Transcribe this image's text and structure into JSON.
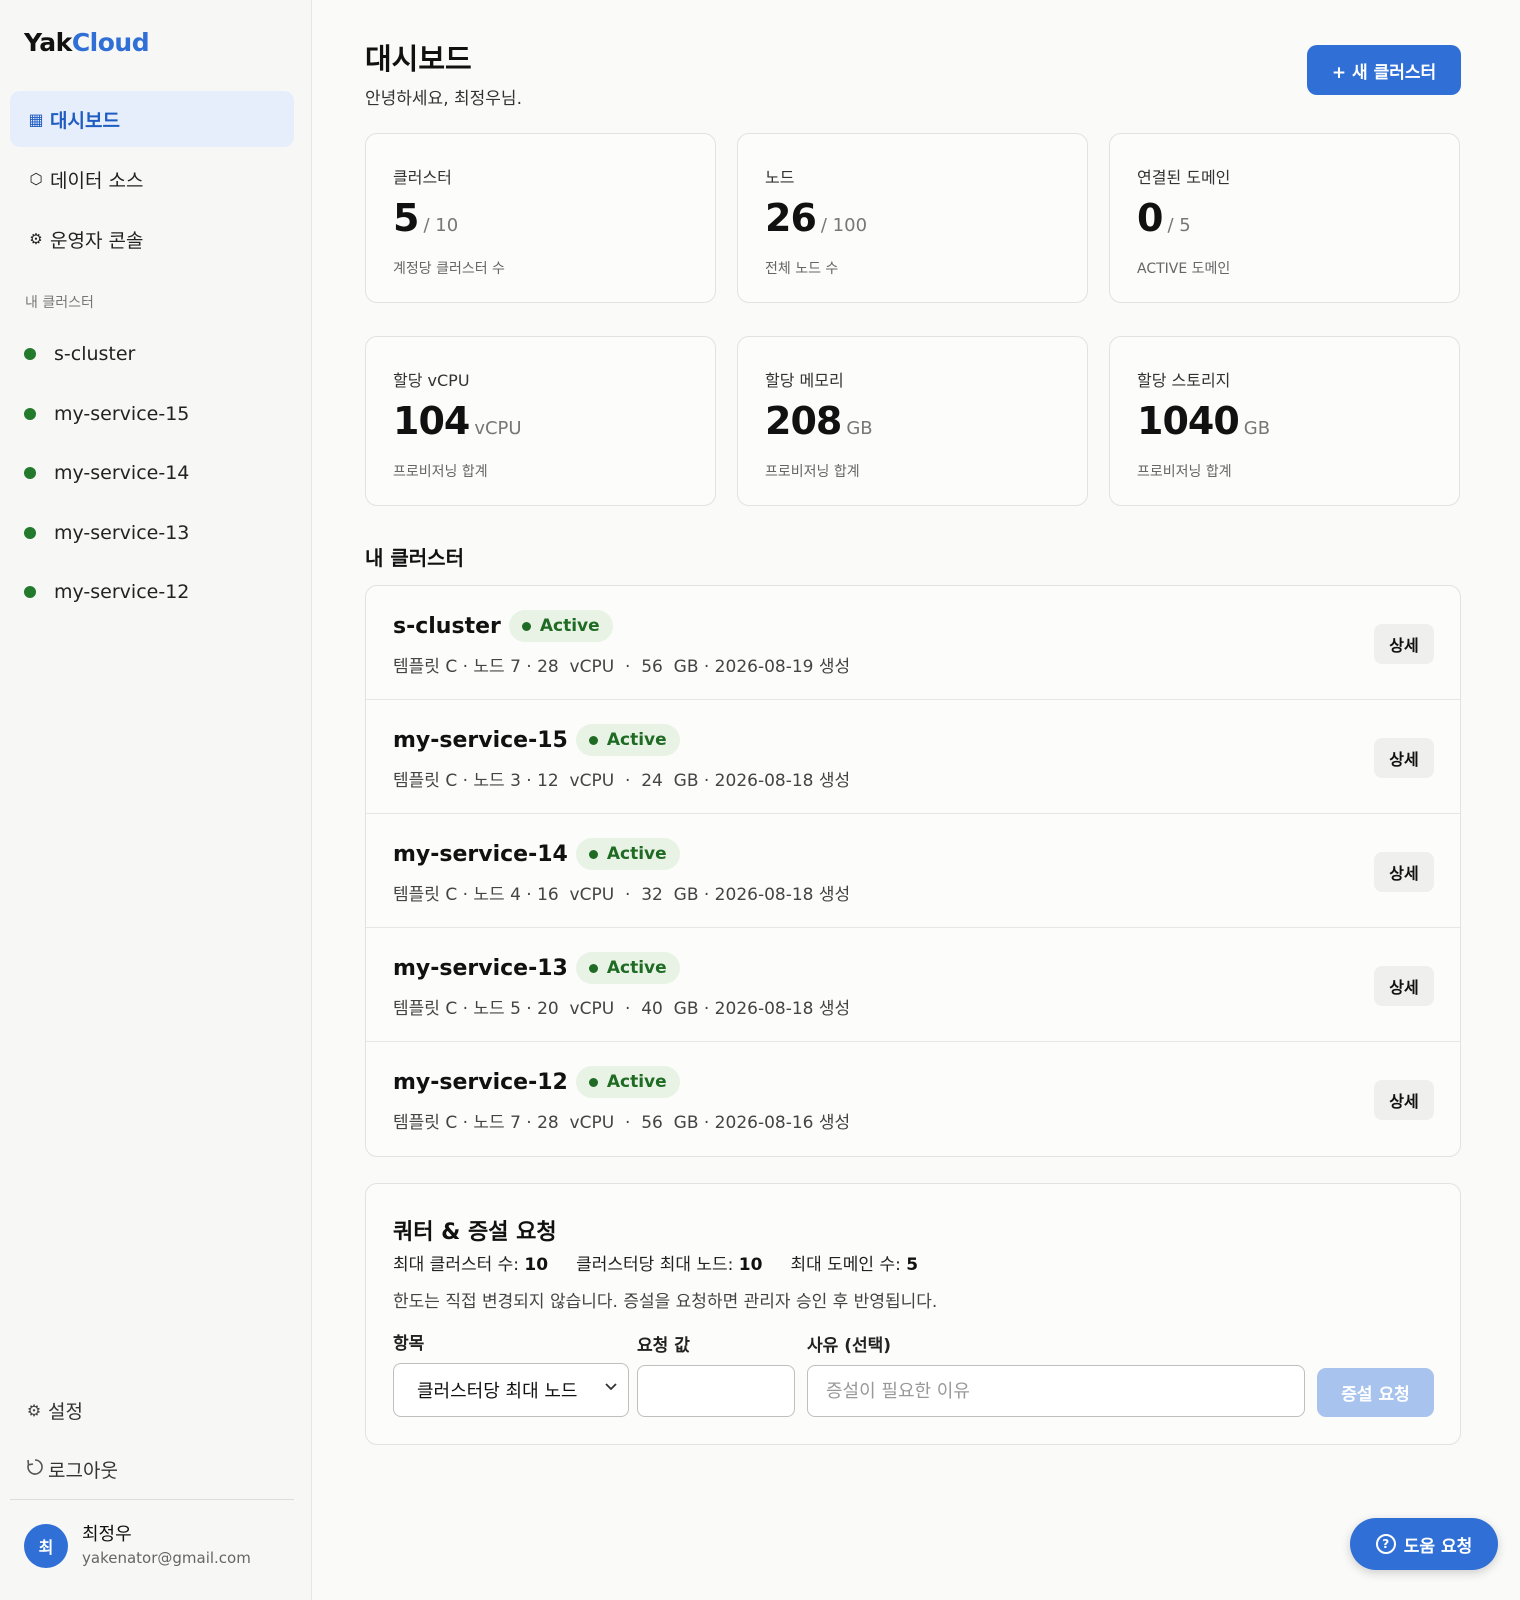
{
  "app": {
    "logo_part1": "Yak",
    "logo_part2": "Cloud"
  },
  "sidebar": {
    "nav": [
      {
        "icon": "grid-icon",
        "glyph": "▦",
        "label": "대시보드"
      },
      {
        "icon": "hexagon-icon",
        "glyph": "⬡",
        "label": "데이터 소스"
      },
      {
        "icon": "gear-icon",
        "glyph": "⚙",
        "label": "운영자 콘솔"
      }
    ],
    "section_label": "내 클러스터",
    "clusters": [
      "s-cluster",
      "my-service-15",
      "my-service-14",
      "my-service-13",
      "my-service-12"
    ],
    "settings": {
      "icon": "gear-icon",
      "glyph": "⚙",
      "label": "설정"
    },
    "logout": {
      "icon": "logout-icon",
      "glyph": "⎋",
      "label": "로그아웃"
    },
    "user": {
      "initial": "최",
      "name": "최정우",
      "email": "yakenator@gmail.com"
    }
  },
  "header": {
    "title": "대시보드",
    "greeting": "안녕하세요, 최정우님.",
    "new_cluster_label": "+ 새 클러스터"
  },
  "stats": [
    {
      "label": "클러스터",
      "value": "5",
      "unit": "/ 10",
      "sub": "계정당 클러스터 수"
    },
    {
      "label": "노드",
      "value": "26",
      "unit": "/ 100",
      "sub": "전체 노드 수"
    },
    {
      "label": "연결된 도메인",
      "value": "0",
      "unit": "/ 5",
      "sub": "ACTIVE 도메인"
    },
    {
      "label": "할당 vCPU",
      "value": "104",
      "unit": "vCPU",
      "sub": "프로비저닝 합계"
    },
    {
      "label": "할당 메모리",
      "value": "208",
      "unit": "GB",
      "sub": "프로비저닝 합계"
    },
    {
      "label": "할당 스토리지",
      "value": "1040",
      "unit": "GB",
      "sub": "프로비저닝 합계"
    }
  ],
  "clusters_section": {
    "title": "내 클러스터",
    "rows": [
      {
        "name": "s-cluster",
        "status": "Active",
        "meta": "템플릿 C · 노드 7 · 28  vCPU  ·  56  GB · 2026-08-19 생성",
        "detail": "상세"
      },
      {
        "name": "my-service-15",
        "status": "Active",
        "meta": "템플릿 C · 노드 3 · 12  vCPU  ·  24  GB · 2026-08-18 생성",
        "detail": "상세"
      },
      {
        "name": "my-service-14",
        "status": "Active",
        "meta": "템플릿 C · 노드 4 · 16  vCPU  ·  32  GB · 2026-08-18 생성",
        "detail": "상세"
      },
      {
        "name": "my-service-13",
        "status": "Active",
        "meta": "템플릿 C · 노드 5 · 20  vCPU  ·  40  GB · 2026-08-18 생성",
        "detail": "상세"
      },
      {
        "name": "my-service-12",
        "status": "Active",
        "meta": "템플릿 C · 노드 7 · 28  vCPU  ·  56  GB · 2026-08-16 생성",
        "detail": "상세"
      }
    ]
  },
  "quota": {
    "title": "쿼터 & 증설 요청",
    "limits": [
      {
        "label": "최대 클러스터 수:",
        "value": "10"
      },
      {
        "label": "클러스터당 최대 노드:",
        "value": "10"
      },
      {
        "label": "최대 도메인 수:",
        "value": "5"
      }
    ],
    "note": "한도는 직접 변경되지 않습니다. 증설을 요청하면 관리자 승인 후 반영됩니다.",
    "item_label": "항목",
    "item_selected": "클러스터당 최대 노드",
    "value_label": "요청 값",
    "value_current": "",
    "reason_label": "사유 (선택)",
    "reason_placeholder": "증설이 필요한 이유",
    "submit_label": "증설 요청"
  },
  "help": {
    "label": "도움 요청",
    "icon": "question-icon"
  },
  "colors": {
    "accent": "#2f6fd6",
    "active_green": "#1f6b24",
    "badge_bg": "#e8f3e6"
  }
}
